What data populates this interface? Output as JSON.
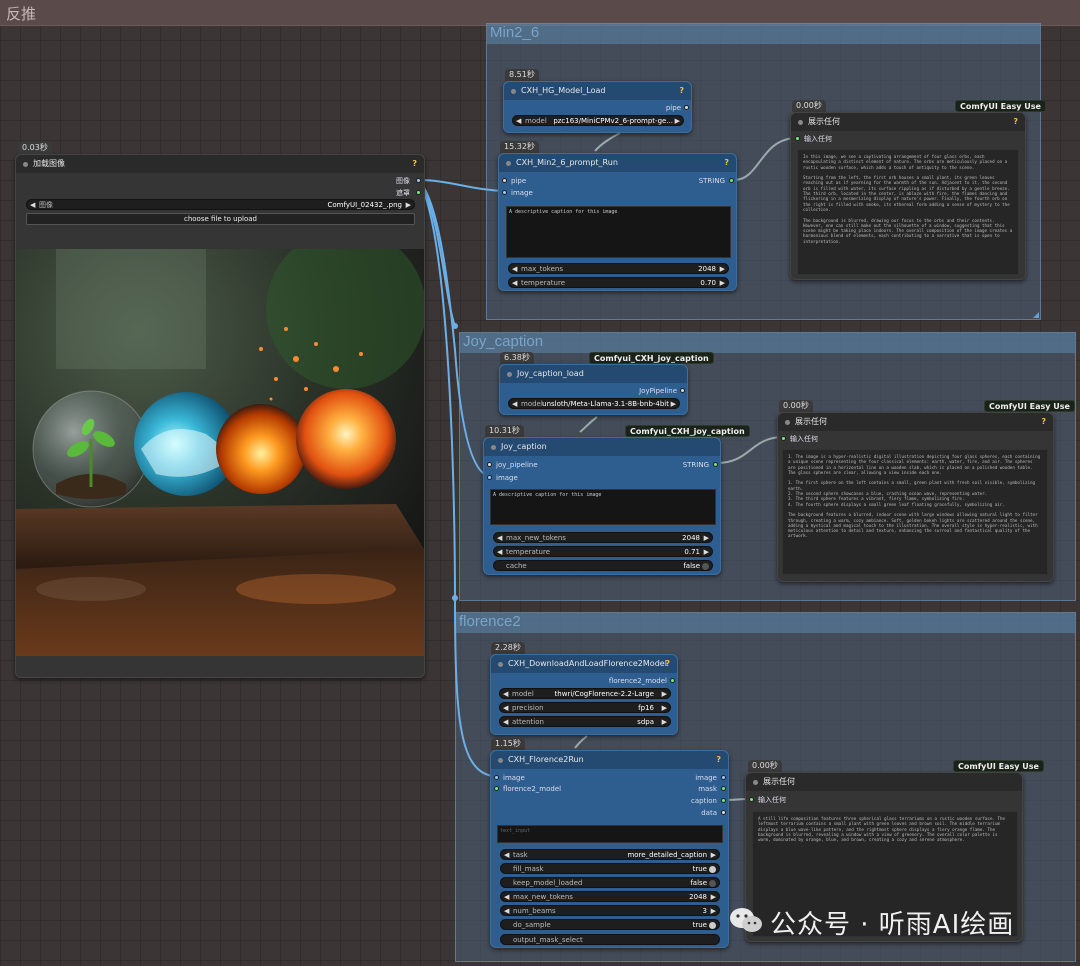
{
  "workflow_title": "反推",
  "groups": {
    "min": {
      "title": "Min2_6"
    },
    "joy": {
      "title": "Joy_caption"
    },
    "florence": {
      "title": "florence2"
    }
  },
  "load_image": {
    "time": "0.03秒",
    "title": "加载图像",
    "help": "?",
    "out_image": "图像",
    "out_mask": "遮罩",
    "image_label": "图像",
    "image_value": "ComfyUI_02432_.png",
    "upload_button": "choose file to upload"
  },
  "hg_load": {
    "time": "8.51秒",
    "title": "CXH_HG_Model_Load",
    "help": "?",
    "out_pipe": "pipe",
    "model_label": "model",
    "model_value": "pzc163/MiniCPMv2_6-prompt-ge..."
  },
  "min_run": {
    "time": "15.32秒",
    "title": "CXH_Min2_6_prompt_Run",
    "help": "?",
    "in_pipe": "pipe",
    "in_image": "image",
    "out_string": "STRING",
    "prompt": "A descriptive caption for this image",
    "max_tokens_label": "max_tokens",
    "max_tokens_value": "2048",
    "temperature_label": "temperature",
    "temperature_value": "0.70"
  },
  "show1": {
    "time": "0.00秒",
    "tag": "ComfyUI Easy Use",
    "title": "展示任何",
    "help": "?",
    "input_label": "输入任何",
    "text": "In this image, we see a captivating arrangement of four glass orbs, each encapsulating a distinct element of nature. The orbs are meticulously placed on a rustic wooden surface, which adds a touch of antiquity to the scene.\n\nStarting from the left, the first orb houses a small plant, its green leaves reaching out as if yearning for the warmth of the sun. Adjacent to it, the second orb is filled with water, its surface rippling as if disturbed by a gentle breeze. The third orb, located in the center, is ablaze with fire, the flames dancing and flickering in a mesmerizing display of nature's power. Finally, the fourth orb on the right is filled with smoke, its ethereal form adding a sense of mystery to the collection.\n\nThe background is blurred, drawing our focus to the orbs and their contents. However, one can still make out the silhouette of a window, suggesting that this scene might be taking place indoors. The overall composition of the image creates a harmonious blend of elements, each contributing to a narrative that is open to interpretation."
  },
  "joy_load": {
    "time": "6.38秒",
    "tag": "Comfyui_CXH_joy_caption",
    "title": "Joy_caption_load",
    "out_pipe": "JoyPipeline",
    "model_label": "model",
    "model_value": "unsloth/Meta-Llama-3.1-8B-bnb-4bit"
  },
  "joy_run": {
    "time": "10.31秒",
    "tag": "Comfyui_CXH_joy_caption",
    "title": "Joy_caption",
    "in_pipe": "joy_pipeline",
    "in_image": "image",
    "out_string": "STRING",
    "prompt": "A descriptive caption for this image",
    "max_new_tokens_label": "max_new_tokens",
    "max_new_tokens_value": "2048",
    "temperature_label": "temperature",
    "temperature_value": "0.71",
    "cache_label": "cache",
    "cache_value": "false"
  },
  "show2": {
    "time": "0.00秒",
    "tag": "ComfyUI Easy Use",
    "title": "展示任何",
    "help": "?",
    "input_label": "输入任何",
    "text": "1. The image is a hyper-realistic digital illustration depicting four glass spheres, each containing a unique scene representing the four classical elements: earth, water, fire, and air. The spheres are positioned in a horizontal line on a wooden slab, which is placed on a polished wooden table. The glass spheres are clear, allowing a view inside each one.\n\n1. The first sphere on the left contains a small, green plant with fresh soil visible, symbolizing earth.\n2. The second sphere showcases a blue, crashing ocean wave, representing water.\n3. The third sphere features a vibrant, fiery flame, symbolizing fire.\n4. The fourth sphere displays a small green leaf floating gracefully, symbolizing air.\n\nThe background features a blurred, indoor scene with large windows allowing natural light to filter through, creating a warm, cozy ambiance. Soft, golden bokeh lights are scattered around the scene, adding a mystical and magical touch to the illustration. The overall style is hyper-realistic, with meticulous attention to detail and texture, enhancing the surreal and fantastical quality of the artwork."
  },
  "flo_load": {
    "time": "2.28秒",
    "title": "CXH_DownloadAndLoadFlorence2Model",
    "help": "?",
    "out_model": "florence2_model",
    "model_label": "model",
    "model_value": "thwri/CogFlorence-2.2-Large",
    "precision_label": "precision",
    "precision_value": "fp16",
    "attention_label": "attention",
    "attention_value": "sdpa"
  },
  "flo_run": {
    "time": "1.15秒",
    "title": "CXH_Florence2Run",
    "help": "?",
    "in_image": "image",
    "in_model": "florence2_model",
    "out_image": "image",
    "out_mask": "mask",
    "out_caption": "caption",
    "out_data": "data",
    "prompt_placeholder": "text_input",
    "task_label": "task",
    "task_value": "more_detailed_caption",
    "fill_mask_label": "fill_mask",
    "fill_mask_value": "true",
    "keep_label": "keep_model_loaded",
    "keep_value": "false",
    "max_new_tokens_label": "max_new_tokens",
    "max_new_tokens_value": "2048",
    "num_beams_label": "num_beams",
    "num_beams_value": "3",
    "do_sample_label": "do_sample",
    "do_sample_value": "true",
    "output_mask_label": "output_mask_select"
  },
  "show3": {
    "time": "0.00秒",
    "tag": "ComfyUI Easy Use",
    "title": "展示任何",
    "input_label": "输入任何",
    "text": "A still life composition features three spherical glass terrariums on a rustic wooden surface. The leftmost terrarium contains a small plant with green leaves and brown soil. The middle terrarium displays a blue wave-like pattern, and the rightmost sphere displays a fiery orange flame. The background is blurred, revealing a window with a view of greenery. The overall color palette is warm, dominated by orange, blue, and brown, creating a cozy and serene atmosphere."
  },
  "watermark": "公众号 · 听雨AI绘画",
  "colors": {
    "node": "#2d5e8f",
    "node_header": "#244a72",
    "group": "#506e8c",
    "link": "#6ab0e8"
  }
}
